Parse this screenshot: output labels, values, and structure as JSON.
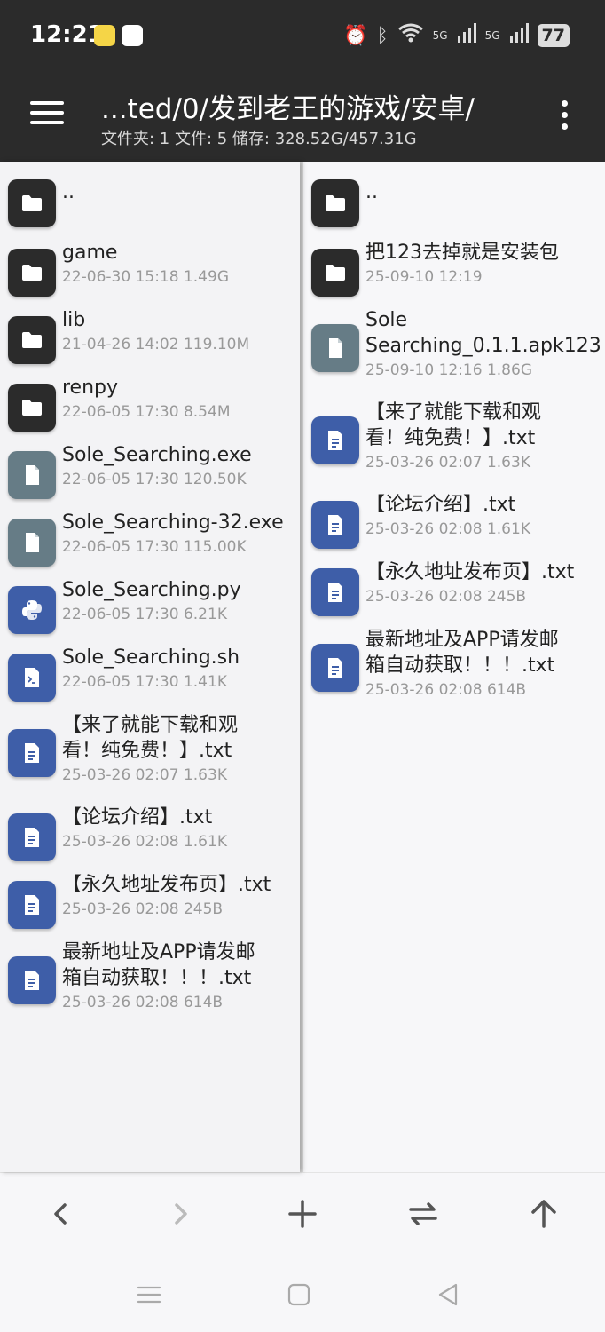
{
  "status": {
    "time": "12:21",
    "battery": "77",
    "net1": "5G",
    "net2": "5G"
  },
  "header": {
    "path": "...ted/0/发到老王的游戏/安卓/",
    "summary": "文件夹: 1  文件: 5  储存: 328.52G/457.31G"
  },
  "left_pane": [
    {
      "type": "folder",
      "icon": "folder-icon",
      "name": "..",
      "meta": ""
    },
    {
      "type": "folder",
      "icon": "folder-icon",
      "name": "game",
      "meta": "22-06-30 15:18  1.49G"
    },
    {
      "type": "folder",
      "icon": "folder-icon",
      "name": "lib",
      "meta": "21-04-26 14:02  119.10M"
    },
    {
      "type": "folder",
      "icon": "folder-icon",
      "name": "renpy",
      "meta": "22-06-05 17:30  8.54M"
    },
    {
      "type": "file",
      "icon": "file-icon",
      "name": "Sole_Searching.exe",
      "meta": "22-06-05 17:30  120.50K"
    },
    {
      "type": "file",
      "icon": "file-icon",
      "name": "Sole_Searching-32.exe",
      "meta": "22-06-05 17:30  115.00K"
    },
    {
      "type": "py",
      "icon": "python-icon",
      "name": "Sole_Searching.py",
      "meta": "22-06-05 17:30  6.21K"
    },
    {
      "type": "sh",
      "icon": "terminal-icon",
      "name": "Sole_Searching.sh",
      "meta": "22-06-05 17:30  1.41K"
    },
    {
      "type": "doc",
      "icon": "document-icon",
      "name": "【来了就能下载和观\n看！纯免费！】.txt",
      "meta": "25-03-26 02:07  1.63K"
    },
    {
      "type": "doc",
      "icon": "document-icon",
      "name": "【论坛介绍】.txt",
      "meta": "25-03-26 02:08  1.61K"
    },
    {
      "type": "doc",
      "icon": "document-icon",
      "name": "【永久地址发布页】.txt",
      "meta": "25-03-26 02:08  245B"
    },
    {
      "type": "doc",
      "icon": "document-icon",
      "name": "最新地址及APP请发邮\n箱自动获取！！！.txt",
      "meta": "25-03-26 02:08  614B"
    }
  ],
  "right_pane": [
    {
      "type": "folder",
      "icon": "folder-icon",
      "name": "..",
      "meta": ""
    },
    {
      "type": "folder",
      "icon": "folder-icon",
      "name": "把123去掉就是安装包",
      "meta": "25-09-10 12:19"
    },
    {
      "type": "file",
      "icon": "file-icon",
      "name": "Sole\nSearching_0.1.1.apk123",
      "meta": "25-09-10 12:16  1.86G"
    },
    {
      "type": "doc",
      "icon": "document-icon",
      "name": "【来了就能下载和观\n看！纯免费！】.txt",
      "meta": "25-03-26 02:07  1.63K"
    },
    {
      "type": "doc",
      "icon": "document-icon",
      "name": "【论坛介绍】.txt",
      "meta": "25-03-26 02:08  1.61K"
    },
    {
      "type": "doc",
      "icon": "document-icon",
      "name": "【永久地址发布页】.txt",
      "meta": "25-03-26 02:08  245B"
    },
    {
      "type": "doc",
      "icon": "document-icon",
      "name": "最新地址及APP请发邮\n箱自动获取！！！.txt",
      "meta": "25-03-26 02:08  614B"
    }
  ],
  "toolbar": [
    "back-icon",
    "forward-icon",
    "add-icon",
    "swap-icon",
    "up-icon"
  ],
  "colors": {
    "folder": "#2b2b2b",
    "file": "#667c86",
    "doc": "#3e5ea8",
    "header": "#2b2b2b"
  }
}
